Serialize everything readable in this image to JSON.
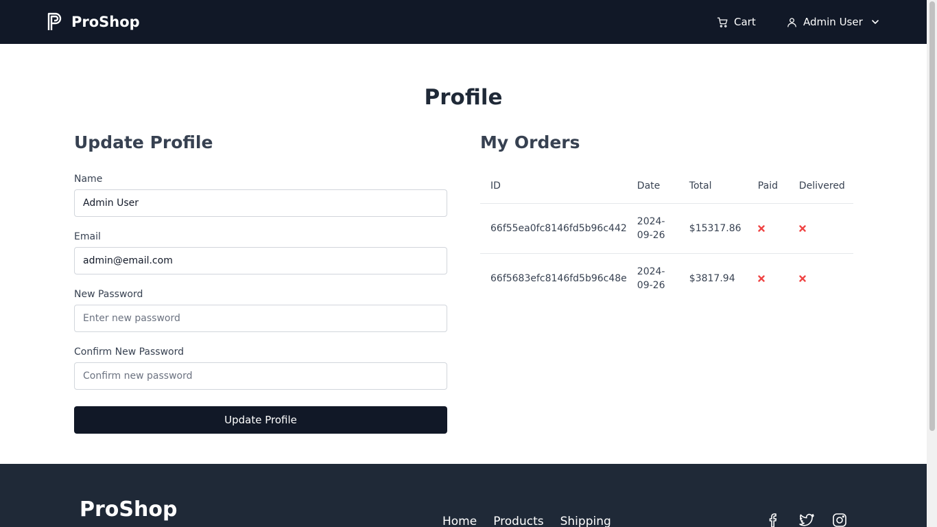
{
  "header": {
    "brand": "ProShop",
    "cart_label": "Cart",
    "user_label": "Admin User"
  },
  "page": {
    "title": "Profile"
  },
  "update_profile": {
    "title": "Update Profile",
    "name_label": "Name",
    "name_value": "Admin User",
    "email_label": "Email",
    "email_value": "admin@email.com",
    "password_label": "New Password",
    "password_placeholder": "Enter new password",
    "confirm_label": "Confirm New Password",
    "confirm_placeholder": "Confirm new password",
    "submit_label": "Update Profile"
  },
  "orders": {
    "title": "My Orders",
    "columns": [
      "ID",
      "Date",
      "Total",
      "Paid",
      "Delivered"
    ],
    "rows": [
      {
        "id": "66f55ea0fc8146fd5b96c442",
        "date": "2024-09-26",
        "total": "$15317.86",
        "paid": false,
        "delivered": false
      },
      {
        "id": "66f5683efc8146fd5b96c48e",
        "date": "2024-09-26",
        "total": "$3817.94",
        "paid": false,
        "delivered": false
      }
    ]
  },
  "footer": {
    "brand": "ProShop",
    "links": [
      "Home",
      "Products",
      "Shipping"
    ],
    "social": [
      "facebook-icon",
      "twitter-icon",
      "instagram-icon"
    ]
  },
  "colors": {
    "header_bg": "#111827",
    "footer_bg": "#1f2937",
    "button_bg": "#111827",
    "status_no": "#ef4444"
  }
}
